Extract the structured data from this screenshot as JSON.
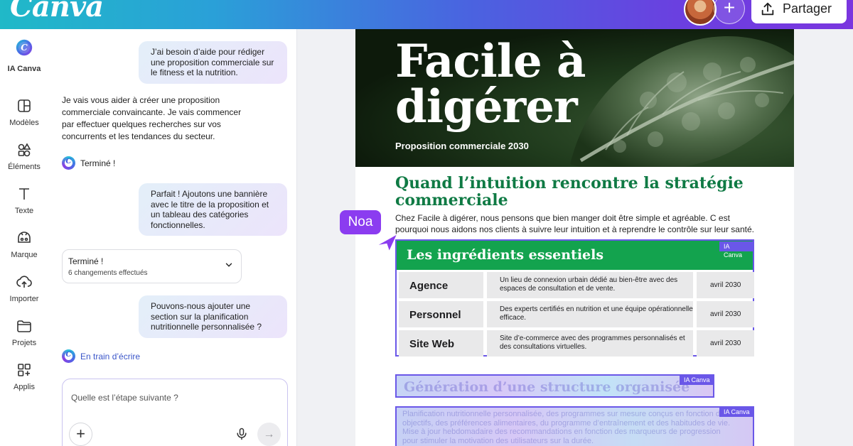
{
  "app": {
    "logo": "Canva",
    "share_label": "Partager"
  },
  "rail": {
    "ai_label": "IA Canva",
    "items": [
      {
        "label": "Modèles",
        "icon": "templates-icon"
      },
      {
        "label": "Éléments",
        "icon": "elements-icon"
      },
      {
        "label": "Texte",
        "icon": "text-icon"
      },
      {
        "label": "Marque",
        "icon": "brand-icon"
      },
      {
        "label": "Importer",
        "icon": "upload-icon"
      },
      {
        "label": "Projets",
        "icon": "folder-icon"
      },
      {
        "label": "Applis",
        "icon": "apps-icon"
      }
    ]
  },
  "chat": {
    "msg1": "J’ai besoin d’aide pour rédiger une proposition commerciale sur le fitness et la nutrition.",
    "ai1": "Je vais vous aider à créer une proposition commerciale convaincante. Je vais commencer par effectuer quelques recherches sur vos concurrents et les tendances du secteur.",
    "done1": "Terminé !",
    "msg2": "Parfait ! Ajoutons une bannière avec le titre de la proposition et un tableau des catégories fonctionnelles.",
    "done_card_title": "Terminé !",
    "done_card_sub": "6 changements effectués",
    "msg3": "Pouvons-nous ajouter une section sur la planification nutritionnelle personnalisée ?",
    "writing": "En train d’écrire",
    "input_placeholder": "Quelle est l’étape suivante ?"
  },
  "doc": {
    "hero_title_line1": "Facile à",
    "hero_title_line2": "digérer",
    "hero_subtitle": "Proposition commerciale 2030",
    "heading": "Quand l’intuition rencontre la stratégie commerciale",
    "intro": "Chez Facile à digérer, nous pensons que bien manger doit être simple et agréable. C est pourquoi nous aidons nos clients à suivre leur intuition et à reprendre le contrôle sur leur santé.",
    "table_title": "Les ingrédients essentiels",
    "ia_tag": "IA Canva",
    "rows": [
      {
        "name": "Agence",
        "desc": "Un lieu de connexion urbain dédié au bien-être avec des espaces de consultation et de vente.",
        "date": "avril 2030"
      },
      {
        "name": "Personnel",
        "desc": "Des experts certifiés en nutrition et une équipe opérationnelle efficace.",
        "date": "avril 2030"
      },
      {
        "name": "Site Web",
        "desc": "Site d’e-commerce avec des programmes personnalisés et des consultations virtuelles.",
        "date": "avril 2030"
      }
    ],
    "gen_title": "Génération d’une structure organisée",
    "gen_para": "Planification nutritionnelle personnalisée, des programmes sur mesure conçus en fonction des objectifs, des préférences alimentaires, du programme d’entraînement et des habitudes de vie. Mise à jour hebdomadaire des recommandations en fonction des marqueurs de progression pour stimuler la motivation des utilisateurs sur la durée."
  },
  "collab": {
    "name": "Noa"
  },
  "colors": {
    "accent": "#6a57e8",
    "brand_green": "#13a34e",
    "heading_green": "#0f7a44",
    "noa_purple": "#8b3cf0"
  }
}
